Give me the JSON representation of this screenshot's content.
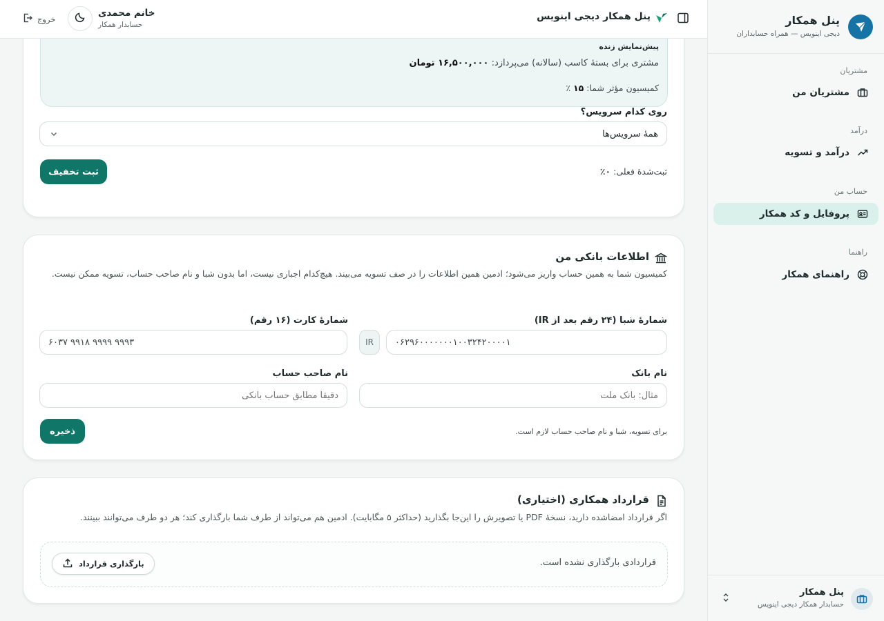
{
  "sidebar": {
    "title": "پنل همکار",
    "subtitle": "دیجی اینویس — همراه حسابداران",
    "sections": [
      {
        "heading": "مشتریان",
        "item": "مشتریان من"
      },
      {
        "heading": "درآمد",
        "item": "درآمد و تسویه"
      },
      {
        "heading": "حساب من",
        "item": "پروفایل و کد همکار"
      },
      {
        "heading": "راهنما",
        "item": "راهنمای همکار"
      }
    ],
    "footer": {
      "title": "پنل همکار",
      "subtitle": "حسابدار همکار دیجی اینویس"
    }
  },
  "topbar": {
    "title": "پنل همکار دیجی اینویس",
    "user_name": "خانم محمدی",
    "user_role": "حسابدار همکار",
    "logout": "خروج"
  },
  "discount_card": {
    "preview_label": "پیش‌نمایش زنده",
    "preview_line1_prefix": "مشتری برای بستهٔ کاسب (سالانه) می‌پردازد:",
    "preview_line1_value": "۱۶,۵۰۰,۰۰۰ تومان",
    "preview_line2_prefix": "کمیسیون مؤثر شما:",
    "preview_line2_value": "۱۵",
    "preview_line2_suffix": "٪",
    "service_label": "روی کدام سرویس؟",
    "service_selected": "همهٔ سرویس‌ها",
    "current_label": "ثبت‌شدهٔ فعلی:",
    "current_value": "۰٪",
    "submit": "ثبت تخفیف"
  },
  "bank_card": {
    "title": "اطلاعات بانکی من",
    "description": "کمیسیون شما به همین حساب واریز می‌شود؛ ادمین همین اطلاعات را در صف تسویه می‌بیند. هیچ‌کدام اجباری نیست، اما بدون شبا و نام صاحب حساب، تسویه ممکن نیست.",
    "sheba_label": "شمارهٔ شبا (۲۴ رقم بعد از IR)",
    "sheba_prefix": "IR",
    "sheba_value": "۰۶۲۹۶۰۰۰۰۰۰۰۱۰۰۳۲۴۲۰۰۰۰۱",
    "card_label": "شمارهٔ کارت (۱۶ رقم)",
    "card_value": "۶۰۳۷ ۹۹۱۸ ۹۹۹۹ ۹۹۹۳",
    "bank_label": "نام بانک",
    "bank_placeholder": "مثال: بانک ملت",
    "holder_label": "نام صاحب حساب",
    "holder_placeholder": "دقیقاً مطابق حساب بانکی",
    "note": "برای تسویه، شبا و نام صاحب حساب لازم است.",
    "save": "ذخیره"
  },
  "contract_card": {
    "title": "قرارداد همکاری (اختیاری)",
    "description": "اگر قرارداد امضاشده دارید، نسخهٔ PDF یا تصویرش را این‌جا بگذارید (حداکثر ۵ مگابایت). ادمین هم می‌تواند از طرف شما بارگذاری کند؛ هر دو طرف می‌توانند ببینند.",
    "empty_text": "قراردادی بارگذاری نشده است.",
    "upload": "بارگذاری قرارداد"
  },
  "colors": {
    "accent": "#0f7668",
    "brand": "#1673a6",
    "active_bg": "#d9f1ea"
  }
}
